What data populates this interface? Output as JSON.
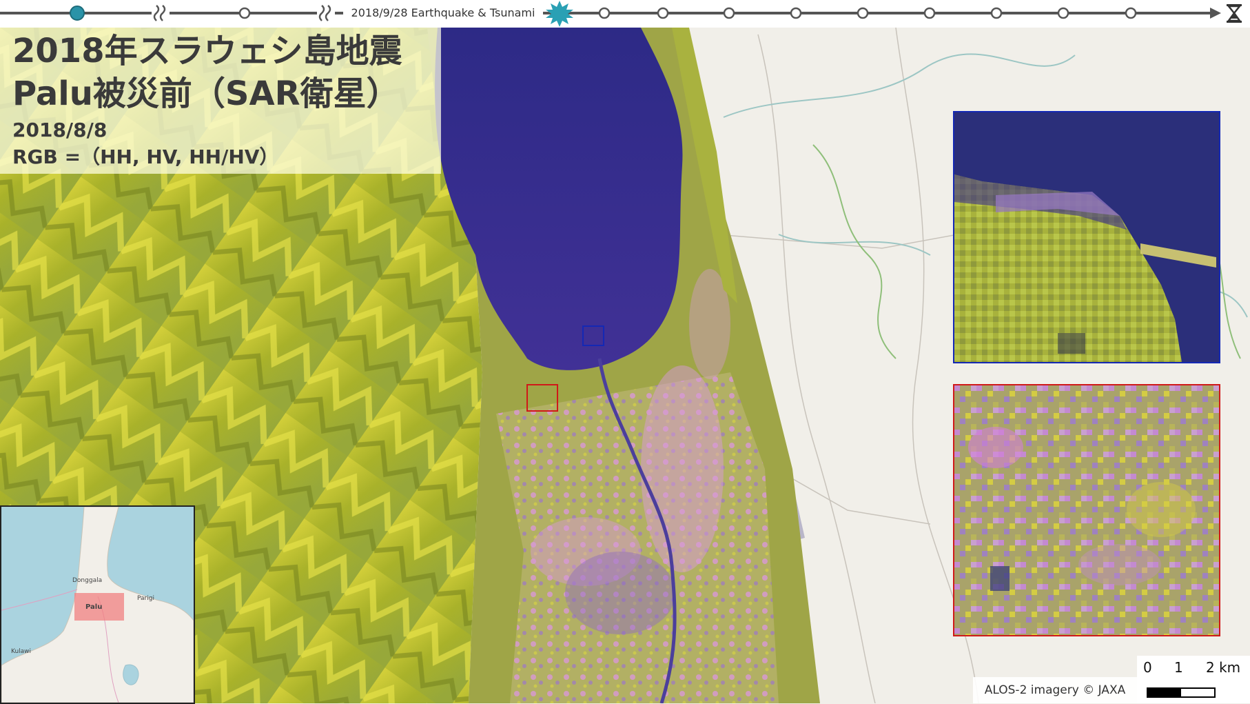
{
  "timeline": {
    "event_label": "2018/9/28 Earthquake & Tsunami",
    "end_icon": "hourglass-icon",
    "current_marker_icon": "filled-circle-icon",
    "event_marker_icon": "starburst-icon",
    "break_icon": "wavy-break-icon",
    "colors": {
      "line": "#555555",
      "current": "#2a93a8",
      "event": "#2aa0b4"
    }
  },
  "title": {
    "line1": "2018年スラウェシ島地震",
    "line2": "Palu被災前（SAR衛星）",
    "date": "2018/8/8",
    "rgb": "RGB =（HH, HV, HH/HV）"
  },
  "map": {
    "colors": {
      "mountains": "#b7bd2c",
      "sea": "#3a2f8e",
      "urban": "#d393d6",
      "basemap": "#f1efe9",
      "river": "#4b3f9c"
    },
    "highlight_boxes": [
      {
        "name": "blue",
        "color": "#1428b4"
      },
      {
        "name": "red",
        "color": "#d01818"
      }
    ]
  },
  "inset": {
    "labels": [
      "Palu",
      "Donggala",
      "Parigi",
      "Kulawi"
    ],
    "colors": {
      "sea": "#aad3df",
      "land": "#f2efe9",
      "highlight": "#f08080"
    }
  },
  "scale": {
    "labels": [
      "0",
      "1",
      "2 km"
    ]
  },
  "credit": "ALOS-2 imagery © JAXA"
}
